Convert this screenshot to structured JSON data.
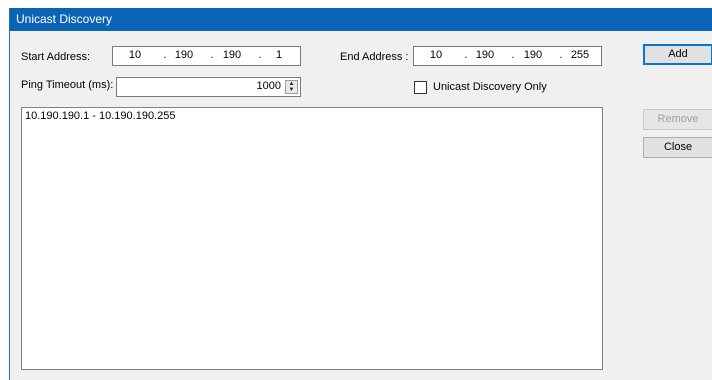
{
  "window": {
    "title": "Unicast Discovery"
  },
  "start_address": {
    "label": "Start Address:",
    "octets": [
      "10",
      "190",
      "190",
      "1"
    ]
  },
  "end_address": {
    "label": "End Address :",
    "octets": [
      "10",
      "190",
      "190",
      "255"
    ]
  },
  "ping_timeout": {
    "label": "Ping Timeout (ms):",
    "value": "1000"
  },
  "unicast_only": {
    "label": "Unicast Discovery Only",
    "checked": false
  },
  "ranges": {
    "items": [
      "10.190.190.1  -  10.190.190.255"
    ]
  },
  "buttons": {
    "add": "Add",
    "remove": "Remove",
    "close": "Close"
  }
}
